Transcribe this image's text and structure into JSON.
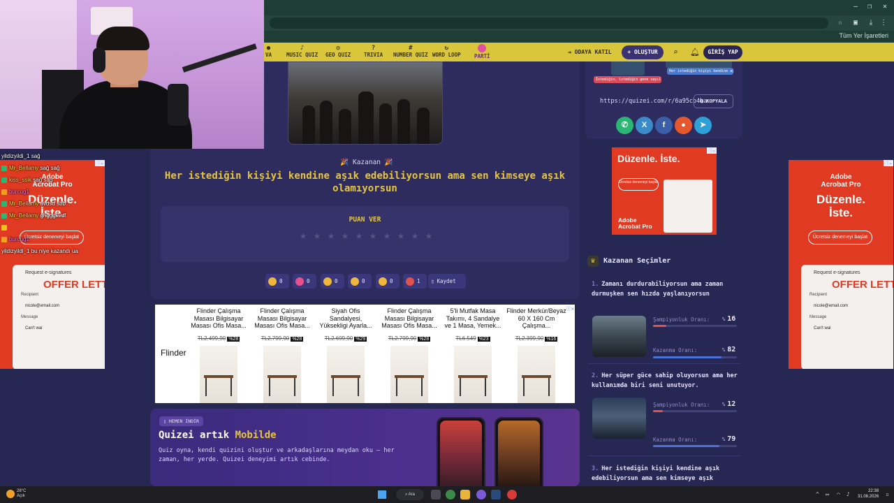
{
  "browser": {
    "bookmarks_label": "Tüm Yer İşaretleri"
  },
  "nav": {
    "items": [
      {
        "label": "VA",
        "icon": "trivia-icon"
      },
      {
        "label": "MUSIC QUIZ",
        "icon": "music-icon"
      },
      {
        "label": "GEO QUIZ",
        "icon": "globe-icon"
      },
      {
        "label": "TRIVIA",
        "icon": "question-icon"
      },
      {
        "label": "NUMBER QUIZ",
        "icon": "number-icon"
      },
      {
        "label": "WORD LOOP",
        "icon": "loop-icon"
      },
      {
        "label": "PARTİ",
        "icon": "party-icon"
      }
    ],
    "odaya_katil": "ODAYA KATIL",
    "olustur": "+ OLUŞTUR",
    "giris": "GİRİŞ YAP"
  },
  "result": {
    "kazanan_label": "🎉 Kazanan 🎉",
    "winner_title": "Her istediğin kişiyi kendine aşık edebiliyorsun ama sen kimseye aşık olamıyorsun",
    "rate_title": "PUAN VER",
    "star_count": 10,
    "reactions": [
      {
        "icon": "thumbs-up-icon",
        "count": "0",
        "color": "#f0b73a"
      },
      {
        "icon": "heart-icon",
        "count": "0",
        "color": "#e8508c"
      },
      {
        "icon": "laugh-icon",
        "count": "0",
        "color": "#f0b73a"
      },
      {
        "icon": "wow-icon",
        "count": "0",
        "color": "#f0b73a"
      },
      {
        "icon": "sad-icon",
        "count": "0",
        "color": "#f0b73a"
      },
      {
        "icon": "angry-icon",
        "count": "1",
        "color": "#e0524c"
      }
    ],
    "save_label": "Kaydet"
  },
  "product_ad": {
    "brand": "Flinder",
    "products": [
      {
        "name": "Flinder Çalışma Masası Bilgisayar Masası Ofis Masa...",
        "price": "TL2.499,90",
        "discount": "%28"
      },
      {
        "name": "Flinder Çalışma Masası Bilgisayar Masası Ofis Masa...",
        "price": "TL2.799,90",
        "discount": "%28"
      },
      {
        "name": "Siyah Ofis Sandalyesi, Yüksekligi Ayarla...",
        "price": "TL2.699,90",
        "discount": "%29"
      },
      {
        "name": "Flinder Çalışma Masası Bilgisayar Masası Ofis Masa...",
        "price": "TL2.799,90",
        "discount": "%28"
      },
      {
        "name": "5'li Mutfak Masa Takımı, 4 Sandalye ve 1 Masa, Yemek...",
        "price": "TL6.549",
        "discount": "%23"
      },
      {
        "name": "Flinder Merkür/Beyaz 60 X 160 Cm Çalışma...",
        "price": "TL2.399,90",
        "discount": "%16"
      }
    ]
  },
  "promo": {
    "badge": "HEMEN İNDİR",
    "title_a": "Quizei artık ",
    "title_b": "Mobilde",
    "text": "Quiz oyna, kendi quizini oluştur ve arkadaşlarına meydan oku — her zaman, her yerde. Quizei deneyimi artık cebinde."
  },
  "share": {
    "url": "https://quizei.com/r/6a95cb4ba",
    "copy_label": "KOPYALA",
    "chat_a": "İstediğin, istediğin gene sayıl...",
    "chat_b": "Her istediğin kişiyi kendine aş..."
  },
  "adobe_mid": {
    "headline": "Düzenle. İste.",
    "cta": "Ücretsiz denemeyi başlat",
    "brand_a": "Adobe",
    "brand_b": "Acrobat Pro"
  },
  "selections": {
    "title": "Kazanan Seçimler",
    "items": [
      {
        "num": "1.",
        "text": "Zamanı durdurabiliyorsun ama zaman durmuşken sen hızda yaşlanıyorsun",
        "champ_label": "Şampiyonluk Oranı:",
        "champ_pct": "16",
        "champ_val": 0.16,
        "win_label": "Kazanma Oranı:",
        "win_pct": "82",
        "win_val": 0.82
      },
      {
        "num": "2.",
        "text": "Her süper güce sahip oluyorsun ama her kullanımda biri seni unutuyor.",
        "champ_label": "Şampiyonluk Oranı:",
        "champ_pct": "12",
        "champ_val": 0.12,
        "win_label": "Kazanma Oranı:",
        "win_pct": "79",
        "win_val": 0.79
      },
      {
        "num": "3.",
        "text": "Her istediğin kişiyi kendine aşık edebiliyorsun ama sen kimseye aşık"
      }
    ],
    "pct_sign": "%"
  },
  "adobe_side": {
    "logo_a": "Adobe",
    "logo_b": "Acrobat Pro",
    "big_a": "Düzenle.",
    "big_b": "İste.",
    "cta": "Ücretsiz denemeyi başlat",
    "req": "Request e-signatures",
    "offer": "OFFER LETT",
    "recipient_label": "Recipient",
    "recipient_val": "nicole@email.com",
    "message_label": "Message",
    "message_val": "Can't wai"
  },
  "chat": [
    {
      "user": "yildizyildi_1",
      "msg": "sağ",
      "color": "#ffffff",
      "badge": ""
    },
    {
      "user": "Mr_Bellamy",
      "msg": "sağ sağ",
      "color": "#f2d94a",
      "badge": "#2bb673"
    },
    {
      "user": "kiss_ssik",
      "msg": "sağ sağ",
      "color": "#f2d94a",
      "badge": "#2bb673"
    },
    {
      "user": "burcug1",
      "msg": "",
      "color": "#f27ad8",
      "badge": "#f0a020"
    },
    {
      "user": "Mr_Bellamy",
      "msg": "avdsd sbb...",
      "color": "#f2d94a",
      "badge": "#2bb673"
    },
    {
      "user": "Mr_Bellamy",
      "msg": "ghgggkvdf",
      "color": "#f2d94a",
      "badge": "#2bb673"
    },
    {
      "user": "",
      "msg": "",
      "color": "#f27ad8",
      "badge": "#f0c020"
    },
    {
      "user": "burcug1",
      "msg": "",
      "color": "#f27ad8",
      "badge": "#f0a020"
    },
    {
      "user": "yildizyildi_1",
      "msg": "bu niye kazandı ua",
      "color": "#ffffff",
      "badge": ""
    }
  ],
  "taskbar": {
    "weather_temp": "28°C",
    "weather_desc": "Açık",
    "search": "Ara",
    "time": "22:38",
    "date": "31.08.2026"
  }
}
